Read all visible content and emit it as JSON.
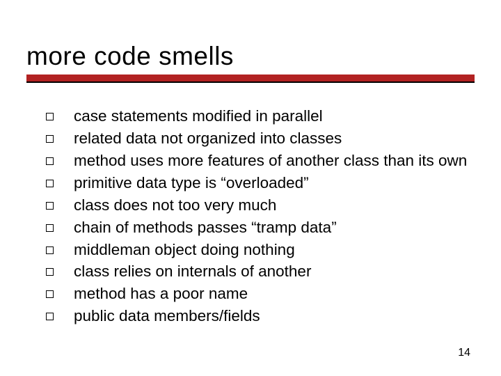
{
  "title": "more code smells",
  "bullets": [
    "case statements modified in parallel",
    "related data not organized into classes",
    "method uses more features of another class than its own",
    "primitive data type is “overloaded”",
    "class does not too very much",
    "chain of methods passes “tramp data”",
    "middleman object doing nothing",
    "class relies on internals of another",
    "method has a poor name",
    "public data members/fields"
  ],
  "page_number": "14"
}
